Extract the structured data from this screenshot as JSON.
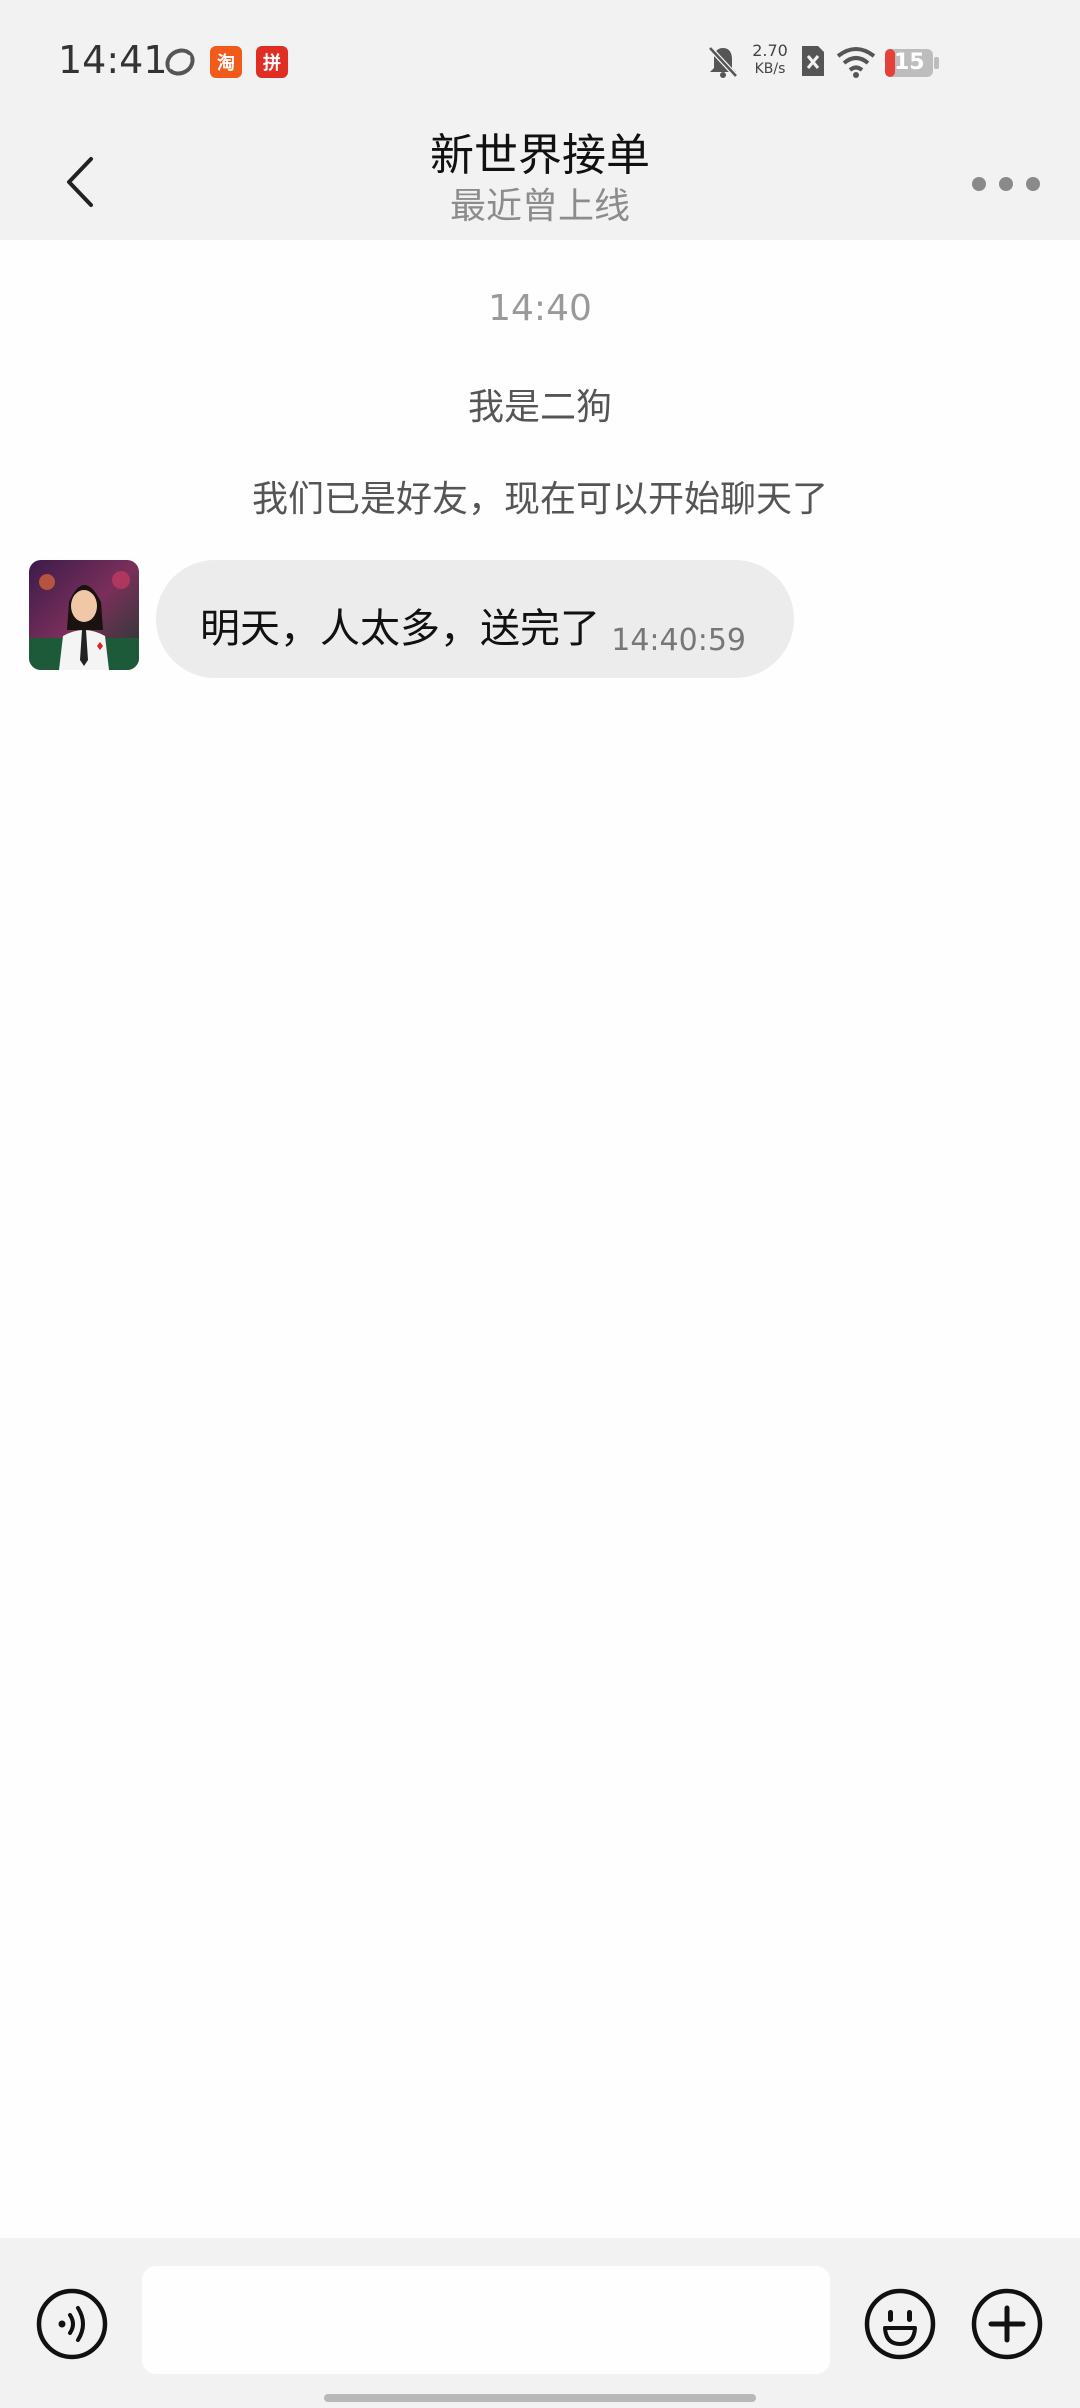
{
  "status_bar": {
    "time": "14:41",
    "net_speed_value": "2.70",
    "net_speed_unit": "KB/s",
    "battery": "15",
    "app_icon_1": "淘",
    "app_icon_2": "拼"
  },
  "header": {
    "title": "新世界接单",
    "subtitle": "最近曾上线"
  },
  "chat": {
    "timestamp": "14:40",
    "system_messages": [
      "我是二狗",
      "我们已是好友，现在可以开始聊天了"
    ],
    "messages": [
      {
        "text": "明天，人太多，送完了",
        "time": "14:40:59",
        "sender": "contact"
      }
    ]
  },
  "input": {
    "placeholder": ""
  },
  "colors": {
    "bar_bg": "#f2f2f2",
    "chat_bg": "#fefefe",
    "bubble_bg": "#ececec",
    "battery_low": "#e5403a"
  }
}
